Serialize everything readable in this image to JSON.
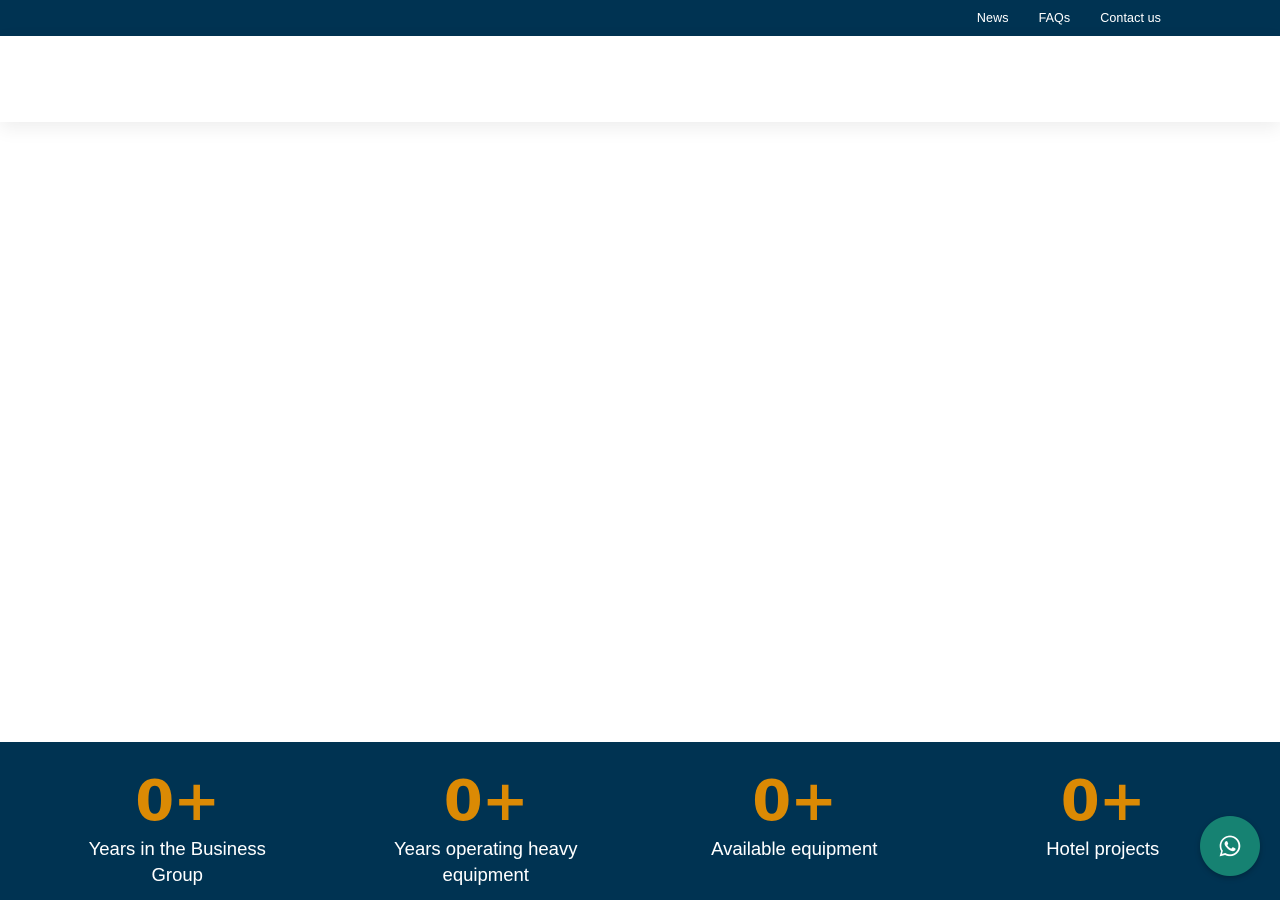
{
  "topbar": {
    "links": [
      {
        "label": "News"
      },
      {
        "label": "FAQs"
      },
      {
        "label": "Contact us"
      }
    ]
  },
  "stats": [
    {
      "value": "0+",
      "label": "Years in the Business Group"
    },
    {
      "value": "0+",
      "label": "Years operating heavy equipment"
    },
    {
      "value": "0+",
      "label": "Available equipment"
    },
    {
      "value": "0+",
      "label": "Hotel projects"
    }
  ],
  "whatsapp": {
    "icon": "whatsapp-icon",
    "color": "#168272"
  },
  "colors": {
    "navy": "#003352",
    "accent": "#db8a04"
  }
}
